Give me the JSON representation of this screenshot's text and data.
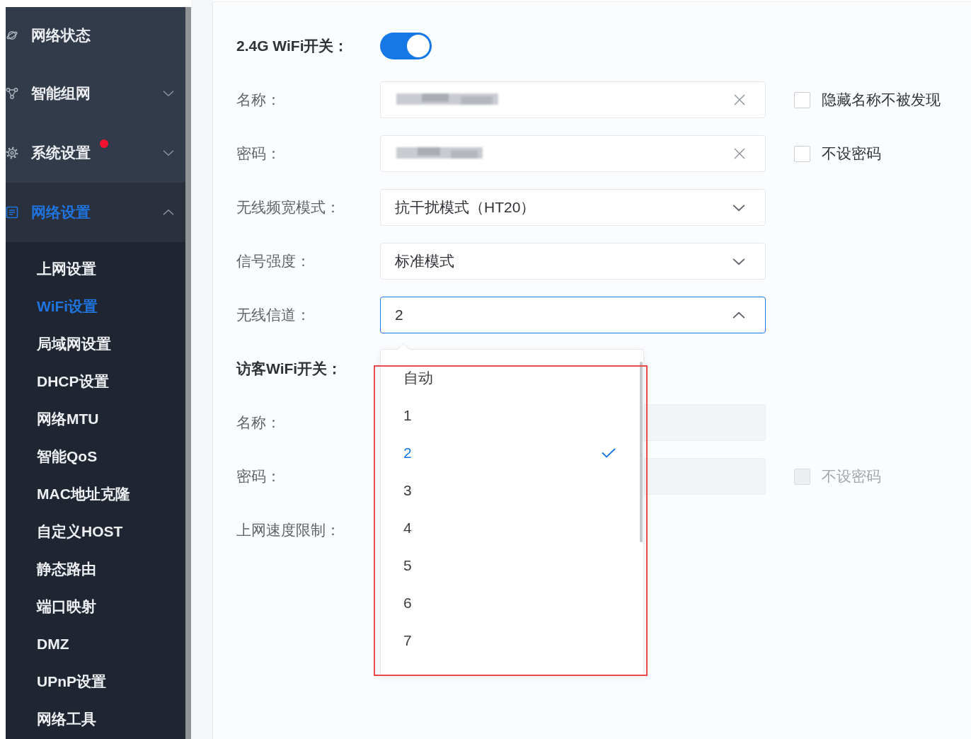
{
  "sidebar": {
    "items": [
      {
        "kind": "link",
        "label": "网络状态",
        "selected": false,
        "alert": false
      },
      {
        "kind": "group",
        "label": "智能组网",
        "selected": false,
        "alert": false,
        "expanded": false
      },
      {
        "kind": "group",
        "label": "系统设置",
        "selected": false,
        "alert": true,
        "expanded": false
      },
      {
        "kind": "group",
        "label": "网络设置",
        "selected": true,
        "alert": false,
        "expanded": true,
        "children": [
          {
            "label": "上网设置",
            "selected": false
          },
          {
            "label": "WiFi设置",
            "selected": true
          },
          {
            "label": "局域网设置",
            "selected": false
          },
          {
            "label": "DHCP设置",
            "selected": false
          },
          {
            "label": "网络MTU",
            "selected": false
          },
          {
            "label": "智能QoS",
            "selected": false
          },
          {
            "label": "MAC地址克隆",
            "selected": false
          },
          {
            "label": "自定义HOST",
            "selected": false
          },
          {
            "label": "静态路由",
            "selected": false
          },
          {
            "label": "端口映射",
            "selected": false
          },
          {
            "label": "DMZ",
            "selected": false
          },
          {
            "label": "UPnP设置",
            "selected": false
          },
          {
            "label": "网络工具",
            "selected": false
          }
        ]
      }
    ]
  },
  "wifi_24g": {
    "label": "2.4G WiFi开关：",
    "on": true
  },
  "fields": [
    {
      "kind": "text",
      "label": "名称：",
      "obscured": true,
      "clearable": true,
      "checkbox": {
        "label": "隐藏名称不被发现",
        "checked": false
      }
    },
    {
      "kind": "text",
      "label": "密码：",
      "obscured": true,
      "clearable": true,
      "checkbox": {
        "label": "不设密码",
        "checked": false
      }
    },
    {
      "kind": "select",
      "label": "无线频宽模式：",
      "value": "抗干扰模式（HT20）",
      "open": false
    },
    {
      "kind": "select",
      "label": "信号强度：",
      "value": "标准模式",
      "open": false
    },
    {
      "kind": "select",
      "label": "无线信道：",
      "value": "2",
      "open": true,
      "options": [
        {
          "label": "自动",
          "selected": false
        },
        {
          "label": "1",
          "selected": false
        },
        {
          "label": "2",
          "selected": true
        },
        {
          "label": "3",
          "selected": false
        },
        {
          "label": "4",
          "selected": false
        },
        {
          "label": "5",
          "selected": false
        },
        {
          "label": "6",
          "selected": false
        },
        {
          "label": "7",
          "selected": false
        }
      ]
    }
  ],
  "guest": {
    "label": "访客WiFi开关：",
    "fields": [
      {
        "kind": "text",
        "label": "名称：",
        "disabled": true
      },
      {
        "kind": "text",
        "label": "密码：",
        "disabled": true,
        "checkbox": {
          "label": "不设密码",
          "checked": false,
          "disabled": true
        }
      },
      {
        "kind": "label",
        "label": "上网速度限制："
      }
    ]
  }
}
